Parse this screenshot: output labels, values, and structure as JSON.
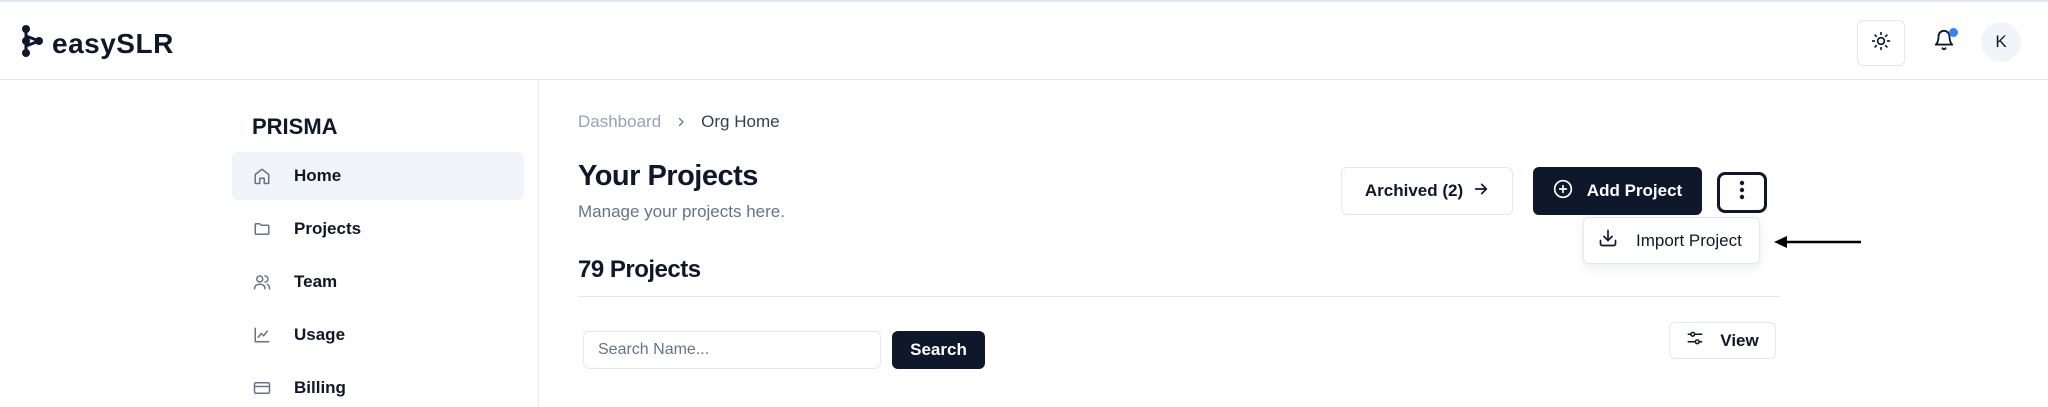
{
  "app": {
    "logo_text": "easySLR"
  },
  "header": {
    "avatar_initial": "K",
    "notification_dot_color": "#3b82f6"
  },
  "sidebar": {
    "heading": "PRISMA",
    "items": [
      {
        "label": "Home",
        "icon": "home-icon",
        "active": true
      },
      {
        "label": "Projects",
        "icon": "folder-icon",
        "active": false
      },
      {
        "label": "Team",
        "icon": "users-icon",
        "active": false
      },
      {
        "label": "Usage",
        "icon": "chart-line-icon",
        "active": false
      },
      {
        "label": "Billing",
        "icon": "credit-card-icon",
        "active": false
      }
    ]
  },
  "breadcrumb": {
    "parent": "Dashboard",
    "current": "Org Home"
  },
  "main": {
    "title": "Your Projects",
    "subtitle": "Manage your projects here.",
    "archived_label": "Archived (2)",
    "add_label": "Add Project",
    "count_heading": "79 Projects"
  },
  "menu": {
    "import_label": "Import Project"
  },
  "search": {
    "placeholder": "Search Name...",
    "value": "",
    "button_label": "Search"
  },
  "view": {
    "label": "View"
  },
  "colors": {
    "primary": "#0f172a",
    "border": "#e2e8f0",
    "muted": "#64748b",
    "active_bg": "#f1f5f9"
  }
}
